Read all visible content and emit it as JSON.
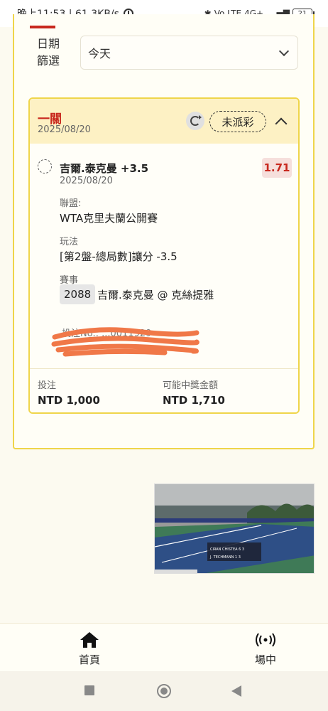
{
  "status_bar": {
    "time_speed": "晚上11:53 | 61.3KB/s",
    "network": "4G+",
    "volte": "Vo LTE",
    "battery": "21"
  },
  "filter": {
    "label": "日期篩選",
    "selected": "今天"
  },
  "bet": {
    "type": "一關",
    "date": "2025/08/20",
    "status": "未派彩",
    "selection": "吉爾.泰克曼 +3.5",
    "selection_date": "2025/08/20",
    "odds": "1.71",
    "league_label": "聯盟:",
    "league": "WTA克里夫蘭公開賽",
    "market_label": "玩法",
    "market": "[第2盤-總局數]讓分 -3.5",
    "event_label": "賽事",
    "event_code": "2088",
    "event_name": "吉爾.泰克曼 @ 克絲提雅",
    "bet_id_label": "投注No.: ...0011929",
    "stake_label": "投注",
    "stake": "NTD 1,000",
    "payout_label": "可能中獎金額",
    "payout": "NTD 1,710"
  },
  "video": {
    "scoreboard": [
      "CIRAN CHISTEA  6  3",
      "J. TECHMANN  1  3"
    ]
  },
  "bottom_nav": {
    "home": "首頁",
    "venue": "場中"
  },
  "colors": {
    "accent_red": "#c8281e",
    "border_yellow": "#efd54a",
    "header_yellow": "#fdf1c4"
  }
}
